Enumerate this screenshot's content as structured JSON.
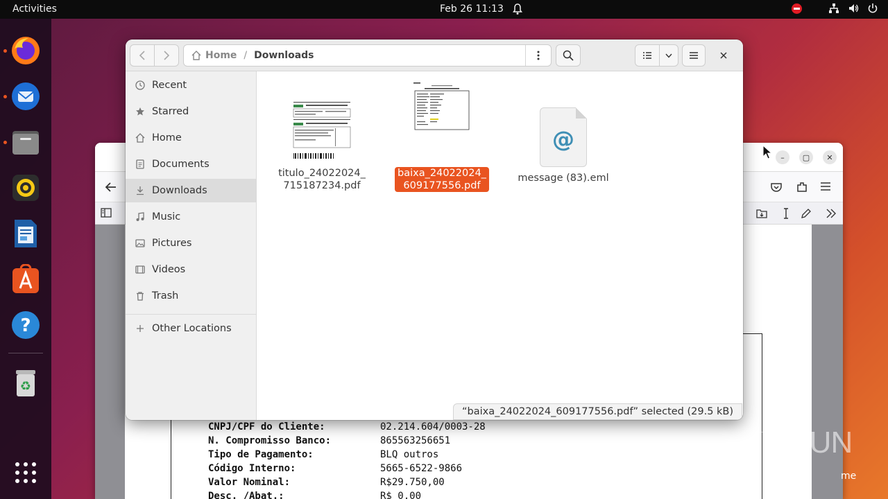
{
  "topbar": {
    "activities": "Activities",
    "clock": "Feb 26  11:13"
  },
  "dock": {
    "apps": [
      "firefox-icon",
      "thunderbird-icon",
      "files-icon",
      "rhythmbox-icon",
      "libreoffice-writer-icon",
      "app-center-icon",
      "help-icon",
      "trash-icon",
      "show-apps-icon"
    ]
  },
  "files": {
    "path": {
      "home": "Home",
      "current": "Downloads"
    },
    "sidebar": [
      {
        "label": "Recent",
        "icon": "clock-icon"
      },
      {
        "label": "Starred",
        "icon": "star-icon"
      },
      {
        "label": "Home",
        "icon": "home-icon"
      },
      {
        "label": "Documents",
        "icon": "document-icon"
      },
      {
        "label": "Downloads",
        "icon": "download-icon",
        "active": true
      },
      {
        "label": "Music",
        "icon": "music-icon"
      },
      {
        "label": "Pictures",
        "icon": "pictures-icon"
      },
      {
        "label": "Videos",
        "icon": "videos-icon"
      },
      {
        "label": "Trash",
        "icon": "trash-icon"
      },
      {
        "label": "Other Locations",
        "icon": "plus-icon"
      }
    ],
    "items": [
      {
        "name_line1": "titulo_24022024_",
        "name_line2": "715187234.pdf",
        "selected": false
      },
      {
        "name_line1": "baixa_24022024_",
        "name_line2": "609177556.pdf",
        "selected": true
      },
      {
        "name_line1": "message (83).eml",
        "name_line2": "",
        "selected": false
      }
    ],
    "status": "“baixa_24022024_609177556.pdf” selected  (29.5 kB)"
  },
  "pdf": {
    "rows": [
      {
        "label": "CNPJ/CPF do Cliente:",
        "value": "02.214.604/0003-28"
      },
      {
        "label": "N. Compromisso Banco:",
        "value": "865563256651"
      },
      {
        "label": "Tipo de Pagamento:",
        "value": "BLQ outros"
      },
      {
        "label": "Código Interno:",
        "value": "5665-6522-9866"
      },
      {
        "label": "Valor Nominal:",
        "value": "R$29.750,00"
      },
      {
        "label": "Desc. /Abat.:",
        "value": "R$ 0,00"
      }
    ]
  },
  "watermark": {
    "text": "ANY RUN",
    "sub": "me"
  },
  "colors": {
    "accent": "#e95420",
    "topbar": "#0c0c0c"
  }
}
